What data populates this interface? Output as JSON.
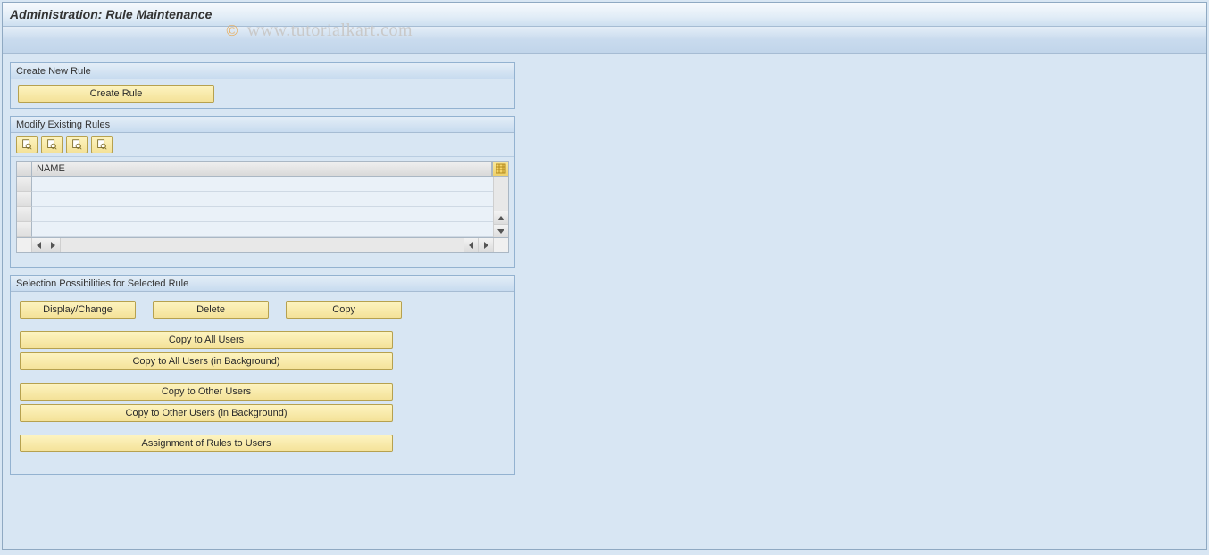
{
  "page_title": "Administration: Rule Maintenance",
  "watermark": "www.tutorialkart.com",
  "copyright_symbol": "©",
  "panels": {
    "create": {
      "title": "Create New Rule",
      "create_btn": "Create Rule"
    },
    "modify": {
      "title": "Modify Existing Rules",
      "column_header": "NAME",
      "toolbar_icons": [
        "details-icon",
        "details-icon",
        "details-icon",
        "details-icon"
      ]
    },
    "selection": {
      "title": "Selection Possibilities for Selected Rule",
      "display_change": "Display/Change",
      "delete": "Delete",
      "copy": "Copy",
      "copy_all": "Copy to All Users",
      "copy_all_bg": "Copy to All Users (in Background)",
      "copy_other": "Copy to Other Users",
      "copy_other_bg": "Copy to Other Users (in Background)",
      "assign": "Assignment of Rules to Users"
    }
  }
}
